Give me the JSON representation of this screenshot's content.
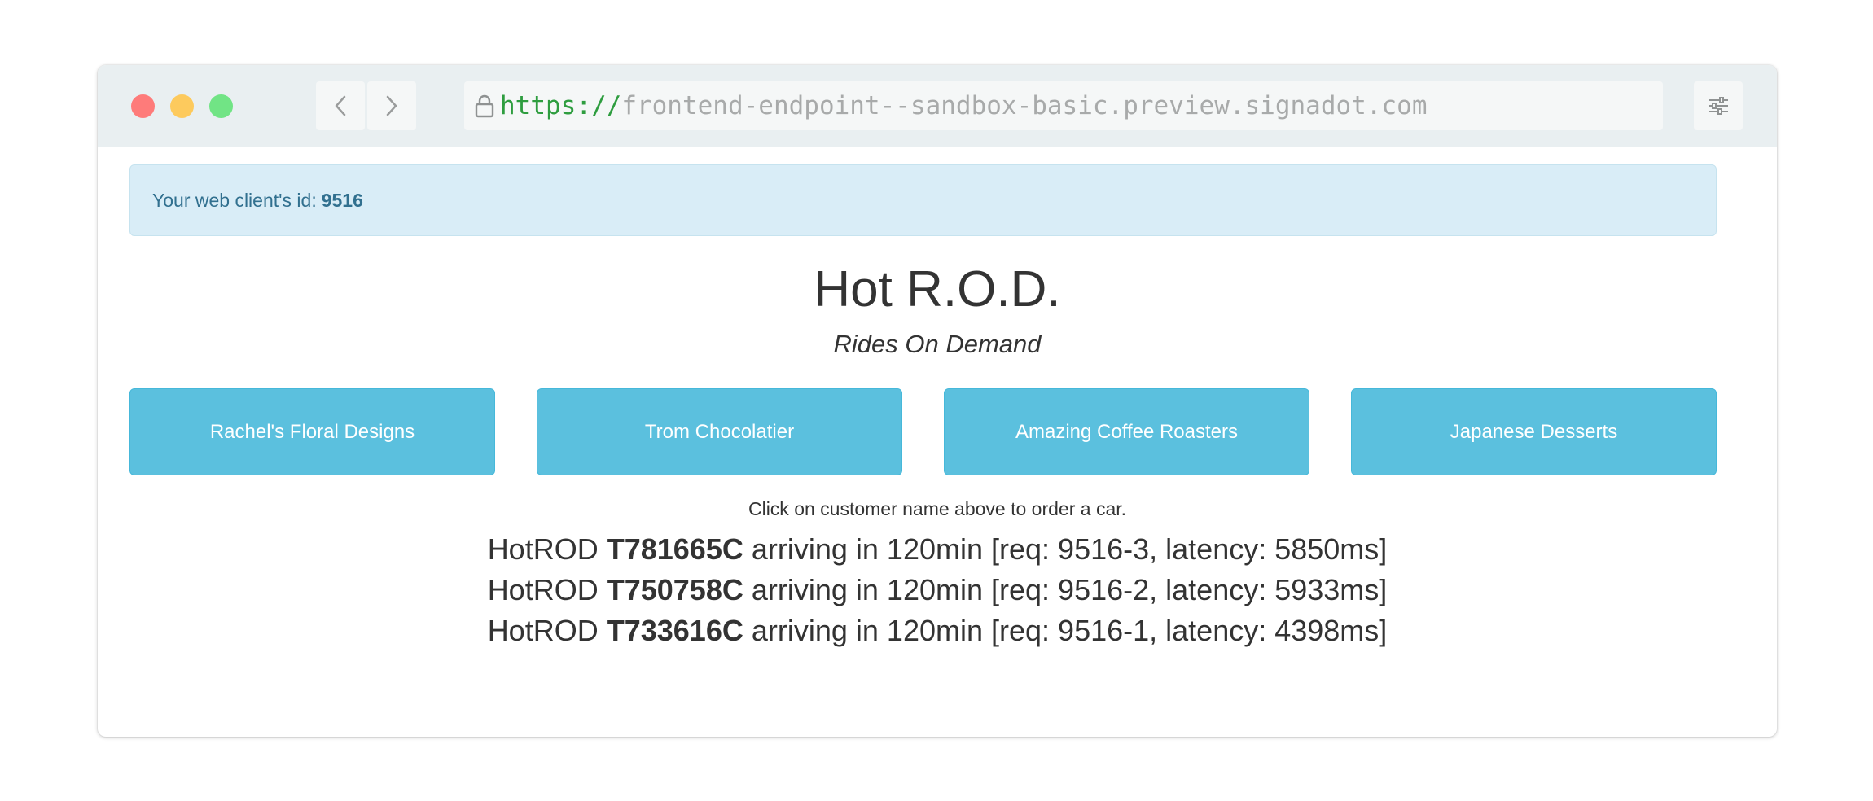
{
  "browser": {
    "url_scheme": "https://",
    "url_host": "frontend-endpoint--sandbox-basic.preview.signadot.com",
    "icons": {
      "back": "chevron-left-icon",
      "forward": "chevron-right-icon",
      "lock": "lock-icon",
      "settings": "sliders-icon"
    },
    "traffic_lights": [
      "#fe7b7a",
      "#fdca5d",
      "#71e485"
    ]
  },
  "alert": {
    "text": "Your web client's id:",
    "client_id": "9516"
  },
  "header": {
    "title": "Hot R.O.D.",
    "subtitle": "Rides On Demand"
  },
  "customers": [
    {
      "label": "Rachel's Floral Designs"
    },
    {
      "label": "Trom Chocolatier"
    },
    {
      "label": "Amazing Coffee Roasters"
    },
    {
      "label": "Japanese Desserts"
    }
  ],
  "hint": "Click on customer name above to order a car.",
  "rides": [
    {
      "prefix": "HotROD",
      "car": "T781665C",
      "details": "arriving in 120min [req: 9516-3, latency: 5850ms]"
    },
    {
      "prefix": "HotROD",
      "car": "T750758C",
      "details": "arriving in 120min [req: 9516-2, latency: 5933ms]"
    },
    {
      "prefix": "HotROD",
      "car": "T733616C",
      "details": "arriving in 120min [req: 9516-1, latency: 4398ms]"
    }
  ],
  "colors": {
    "accent": "#5bc0de",
    "alert_bg": "#d9edf7",
    "alert_text": "#31708f",
    "url_scheme": "#2e9d3f"
  }
}
